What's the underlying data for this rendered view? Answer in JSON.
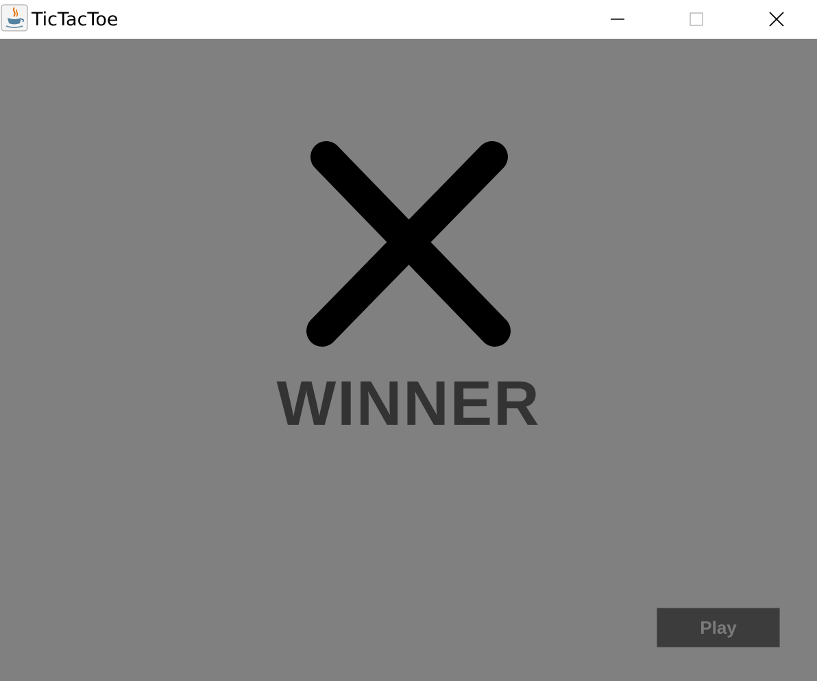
{
  "window": {
    "title": "TicTacToe",
    "app_icon": "java-cup-icon",
    "controls": [
      "minimize-icon",
      "maximize-icon",
      "close-icon"
    ]
  },
  "main": {
    "winner_symbol": "x-icon",
    "winner_label": "WINNER",
    "play_label": "Play"
  },
  "colors": {
    "background": "#808080",
    "winner_text": "#333333",
    "symbol": "#000000",
    "play_bg": "#3c3c3c",
    "play_text": "#7a7a7a"
  }
}
